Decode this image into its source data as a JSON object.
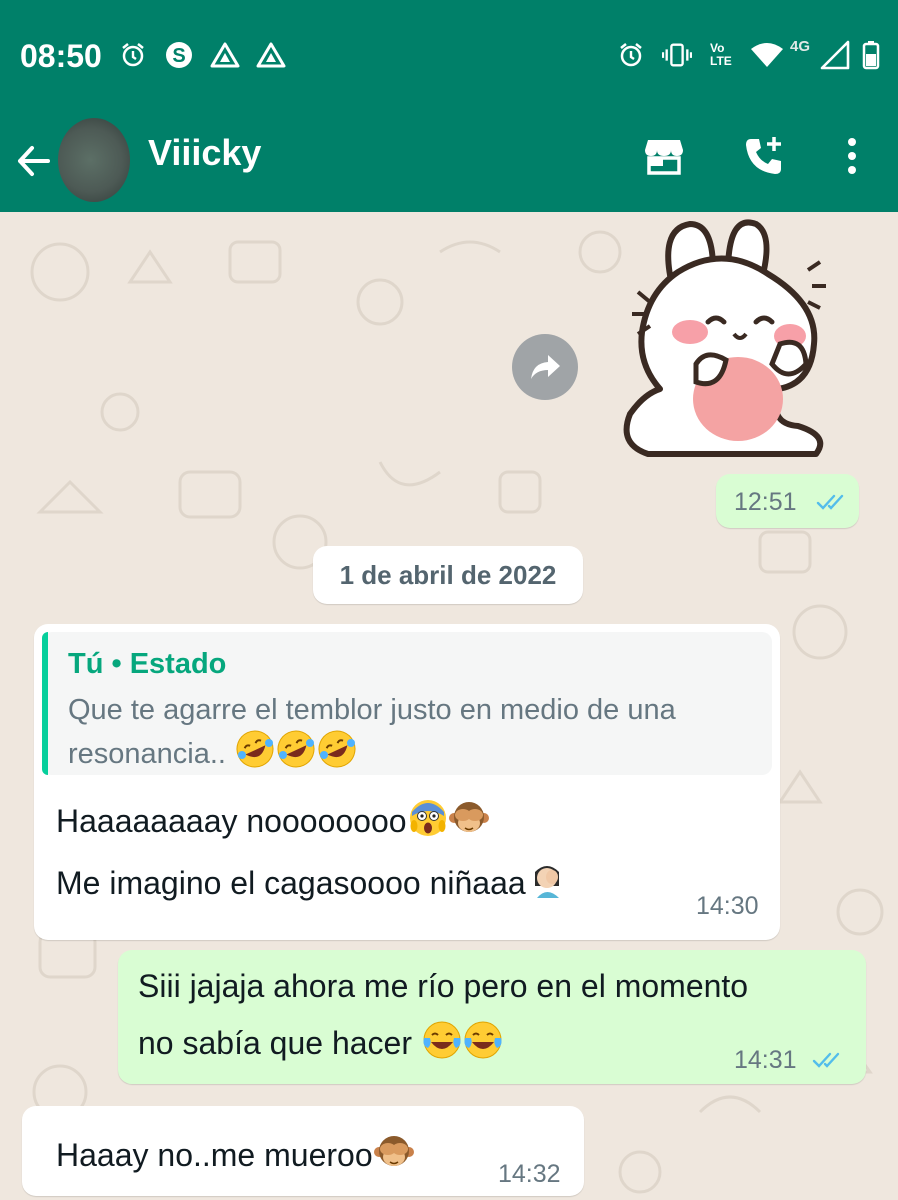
{
  "status_bar": {
    "time": "08:50",
    "left_icons": [
      "alarm-icon",
      "s-app-icon",
      "drive-icon",
      "drive-icon"
    ],
    "right_icons": [
      "alarm-icon",
      "vibrate-icon",
      "volte-icon",
      "wifi-icon",
      "signal-icon",
      "battery-icon"
    ],
    "network_label": "4G",
    "volte_label_top": "Vo",
    "volte_label_bottom": "LTE"
  },
  "header": {
    "contact_name": "Viiicky",
    "actions": [
      "store-icon",
      "add-call-icon",
      "more-icon"
    ]
  },
  "messages": [
    {
      "type": "sticker",
      "direction": "out",
      "time": "12:51",
      "status": "read"
    },
    {
      "type": "date",
      "label": "1 de abril de 2022"
    },
    {
      "type": "text",
      "direction": "in",
      "quote_author": "Tú • Estado",
      "quote_text": "Que te agarre el temblor justo en medio de una resonancia..",
      "line1": "Haaaaaaaay noooooooo",
      "line2": "Me imagino el cagasoooo niñaaa",
      "time": "14:30"
    },
    {
      "type": "text",
      "direction": "out",
      "line1": "Siii jajaja ahora me río pero en el momento",
      "line2": "no sabía que hacer",
      "time": "14:31",
      "status": "read"
    },
    {
      "type": "text",
      "direction": "in",
      "line1": "Haaay no..me mueroo",
      "time": "14:32"
    }
  ],
  "colors": {
    "header": "#008069",
    "chat_background": "#efe7de",
    "outgoing_bubble": "#d9fdd3",
    "incoming_bubble": "#ffffff",
    "read_ticks": "#53bdeb",
    "quote_accent": "#06a77d"
  }
}
